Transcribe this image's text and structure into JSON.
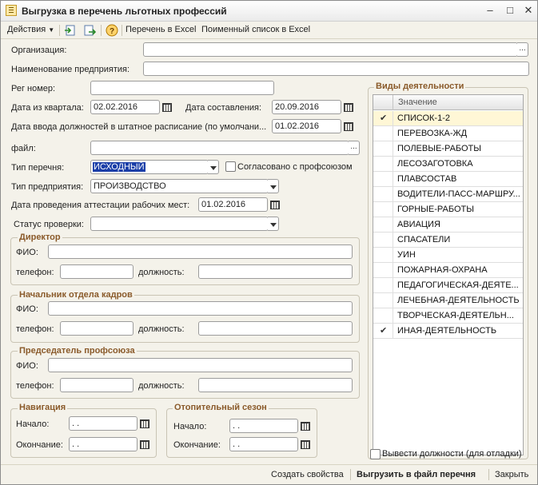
{
  "window": {
    "title": "Выгрузка в перечень льготных профессий"
  },
  "toolbar": {
    "actions": "Действия",
    "excel_list": "Перечень в Excel",
    "excel_names": "Поименный список в Excel"
  },
  "form": {
    "org_label": "Организация:",
    "org_value": "",
    "company_name_label": "Наименование предприятия:",
    "company_name_value": "",
    "reg_label": "Рег номер:",
    "reg_value": "",
    "quarter_date_label": "Дата из квартала:",
    "quarter_date_value": "02.02.2016",
    "compose_date_label": "Дата составления:",
    "compose_date_value": "20.09.2016",
    "staff_date_label": "Дата ввода должностей в штатное расписание (по умолчани...",
    "staff_date_value": "01.02.2016",
    "file_label": "файл:",
    "file_value": "",
    "list_type_label": "Тип перечня:",
    "list_type_value": "ИСХОДНЫЙ",
    "agreed_label": "Согласовано с профсоюзом",
    "company_type_label": "Тип предприятия:",
    "company_type_value": "ПРОИЗВОДСТВО",
    "attest_date_label": "Дата проведения аттестации рабочих мест:",
    "attest_date_value": "01.02.2016",
    "check_status_label": "Статус проверки:",
    "check_status_value": ""
  },
  "groups": {
    "director": {
      "title": "Директор",
      "fio_label": "ФИО:",
      "phone_label": "телефон:",
      "position_label": "должность:"
    },
    "hr": {
      "title": "Начальник отдела кадров",
      "fio_label": "ФИО:",
      "phone_label": "телефон:",
      "position_label": "должность:"
    },
    "union": {
      "title": "Председатель профсоюза",
      "fio_label": "ФИО:",
      "phone_label": "телефон:",
      "position_label": "должность:"
    },
    "navigation": {
      "title": "Навигация",
      "start_label": "Начало:",
      "end_label": "Окончание:",
      "start_value": " .  .",
      "end_value": " .  ."
    },
    "heating": {
      "title": "Отопительный сезон",
      "start_label": "Начало:",
      "end_label": "Окончание:",
      "start_value": " .  .",
      "end_value": " .  ."
    }
  },
  "activities": {
    "title": "Виды деятельности",
    "column": "Значение",
    "items": [
      {
        "label": "СПИСОК-1-2",
        "checked": true
      },
      {
        "label": "ПЕРЕВОЗКА-ЖД",
        "checked": false
      },
      {
        "label": "ПОЛЕВЫЕ-РАБОТЫ",
        "checked": false
      },
      {
        "label": "ЛЕСОЗАГОТОВКА",
        "checked": false
      },
      {
        "label": "ПЛАВСОСТАВ",
        "checked": false
      },
      {
        "label": "ВОДИТЕЛИ-ПАСС-МАРШРУ...",
        "checked": false
      },
      {
        "label": "ГОРНЫЕ-РАБОТЫ",
        "checked": false
      },
      {
        "label": "АВИАЦИЯ",
        "checked": false
      },
      {
        "label": "СПАСАТЕЛИ",
        "checked": false
      },
      {
        "label": "УИН",
        "checked": false
      },
      {
        "label": "ПОЖАРНАЯ-ОХРАНА",
        "checked": false
      },
      {
        "label": "ПЕДАГОГИЧЕСКАЯ-ДЕЯТЕ...",
        "checked": false
      },
      {
        "label": "ЛЕЧЕБНАЯ-ДЕЯТЕЛЬНОСТЬ",
        "checked": false
      },
      {
        "label": "ТВОРЧЕСКАЯ-ДЕЯТЕЛЬН...",
        "checked": false
      },
      {
        "label": "ИНАЯ-ДЕЯТЕЛЬНОСТЬ",
        "checked": true
      }
    ],
    "debug_label": "Вывести должности (для отладки)"
  },
  "footer": {
    "create_props": "Создать свойства",
    "export": "Выгрузить в файл перечня",
    "close": "Закрыть"
  },
  "colors": {
    "group_title": "#8a5a2a",
    "selection": "#1a3ea8",
    "row_highlight": "#fff7d6"
  }
}
